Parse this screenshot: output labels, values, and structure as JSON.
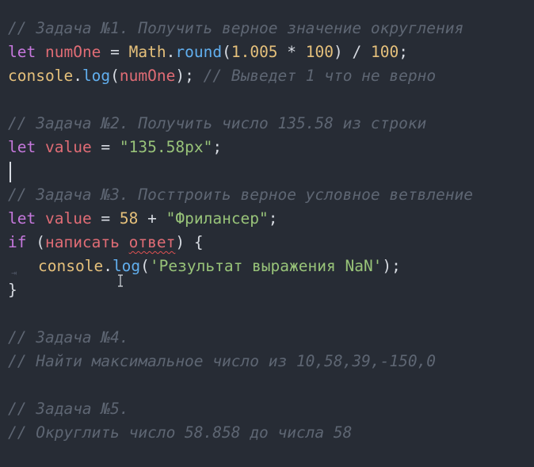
{
  "lines": {
    "l1": "// Задача №1. Получить верное значение округления",
    "l2": {
      "kw": "let",
      "var": "numOne",
      "eq": " = ",
      "obj": "Math",
      "dot": ".",
      "fn": "round",
      "p1": "(",
      "n1": "1.005",
      "mul": " * ",
      "n2": "100",
      "p2": ")",
      "div": " / ",
      "n3": "100",
      "semi": ";"
    },
    "l3": {
      "obj": "console",
      "dot": ".",
      "fn": "log",
      "p1": "(",
      "var": "numOne",
      "p2": ");",
      "comment": " // Выведет 1 что не верно"
    },
    "l5": "// Задача №2. Получить число 135.58 из строки",
    "l6": {
      "kw": "let",
      "var": "value",
      "eq": " = ",
      "str": "\"135.58px\"",
      "semi": ";"
    },
    "l8": "// Задача №3. Посттроить верное условное ветвление",
    "l9": {
      "kw": "let",
      "var": "value",
      "eq": " = ",
      "num": "58",
      "plus": " + ",
      "str": "\"Фрилансер\"",
      "semi": ";"
    },
    "l10": {
      "kw": "if",
      "p1": " (",
      "w1": "написать",
      "w2": "ответ",
      "p2": ") {"
    },
    "l11": {
      "obj": "console",
      "dot": ".",
      "fn": "log",
      "p1": "(",
      "str": "'Результат выражения NaN'",
      "p2": ");"
    },
    "l12": "}",
    "l14": "// Задача №4.",
    "l15": "// Найти максимальное число из 10,58,39,-150,0",
    "l17": "// Задача №5.",
    "l18": "// Округлить число 58.858 до числа 58"
  },
  "colors": {
    "background": "#272c35",
    "comment": "#5e6673",
    "keyword": "#c678dd",
    "variable": "#e06c75",
    "number": "#e5c07b",
    "string": "#98c379",
    "function": "#61afef"
  }
}
